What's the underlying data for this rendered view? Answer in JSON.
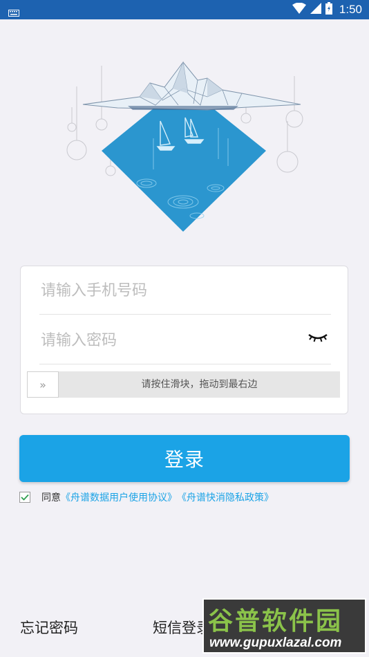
{
  "status_bar": {
    "time": "1:50"
  },
  "form": {
    "phone_placeholder": "请输入手机号码",
    "password_placeholder": "请输入密码",
    "slider_text": "请按住滑块，拖动到最右边",
    "slider_handle": "»"
  },
  "login_button": "登录",
  "agreement": {
    "prefix": "同意",
    "link1": "《舟谱数据用户使用协议》",
    "link2": "《舟谱快消隐私政策》"
  },
  "bottom_links": {
    "forgot": "忘记密码",
    "sms": "短信登录"
  },
  "watermark": {
    "title": "谷普软件园",
    "url": "www.gupuxlazal.com"
  },
  "colors": {
    "status_bar": "#1d62b0",
    "accent": "#1ba3e6",
    "background": "#f2f1f6",
    "hero_diamond": "#2b96cf"
  }
}
